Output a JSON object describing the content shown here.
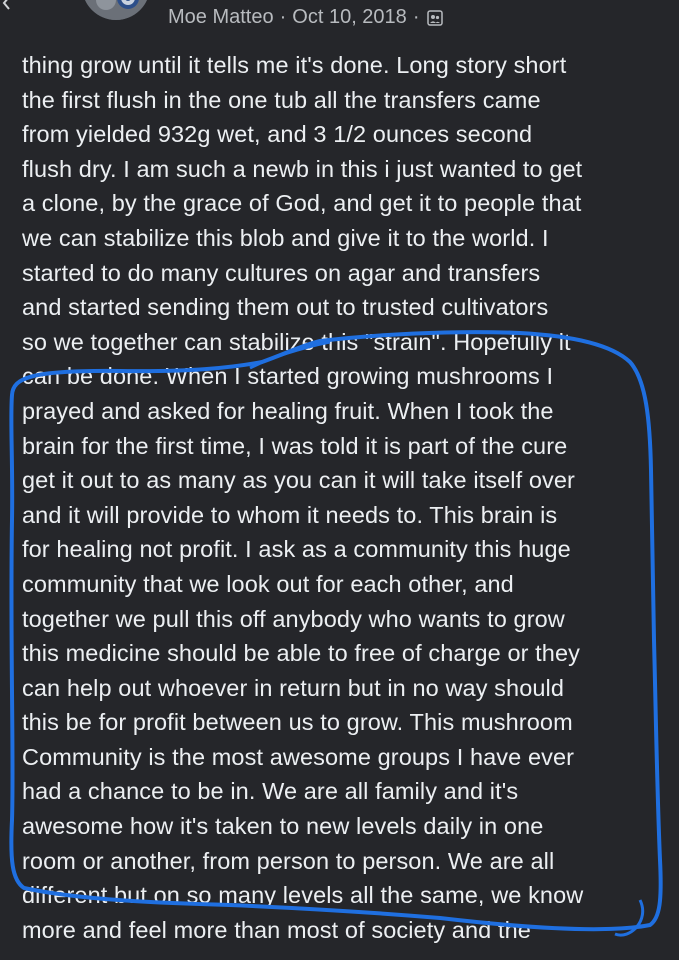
{
  "post": {
    "author": "Moe Matteo",
    "separator": "·",
    "date": "Oct 10, 2018",
    "audience_icon": "friends-icon",
    "lines": [
      "thing grow until it tells me it's done. Long story short",
      "the first flush in the one tub all the transfers came",
      "from yielded 932g wet, and 3 1/2 ounces second",
      "flush dry. I am such a newb in this i just wanted to get",
      "a clone, by the grace of God, and get it to people that",
      "we can stabilize this blob and give it to the world. I",
      "started to do many cultures on agar and transfers",
      "and started sending them out to trusted cultivators",
      "so we together can stabilize this \"strain\". Hopefully it",
      "can be done. When I started growing mushrooms I",
      "prayed and asked for healing fruit. When I took the",
      "brain for the first time, I was told it is part of the cure",
      "get it out to as many as you can it will take itself over",
      "and it will provide to whom it needs to. This brain is",
      "for healing not profit. I ask as a community this huge",
      "community that we look out for each other, and",
      "together we pull this off anybody who wants to grow",
      "this medicine should be able to free of charge or they",
      "can help out whoever in return but in no way should",
      "this be for profit between us to grow. This mushroom",
      "Community   is the most awesome groups I have ever",
      "had a chance to be in. We are all family and it's",
      "awesome how it's taken to new levels daily in one",
      "room or another, from person to person. We are all",
      "different but on so many levels all the same, we know",
      "more and feel more than most of society and the"
    ]
  },
  "colors": {
    "background": "#25262a",
    "text": "#eceff2",
    "meta": "#b8bbbf",
    "highlight_outline": "#1f6fe0"
  }
}
